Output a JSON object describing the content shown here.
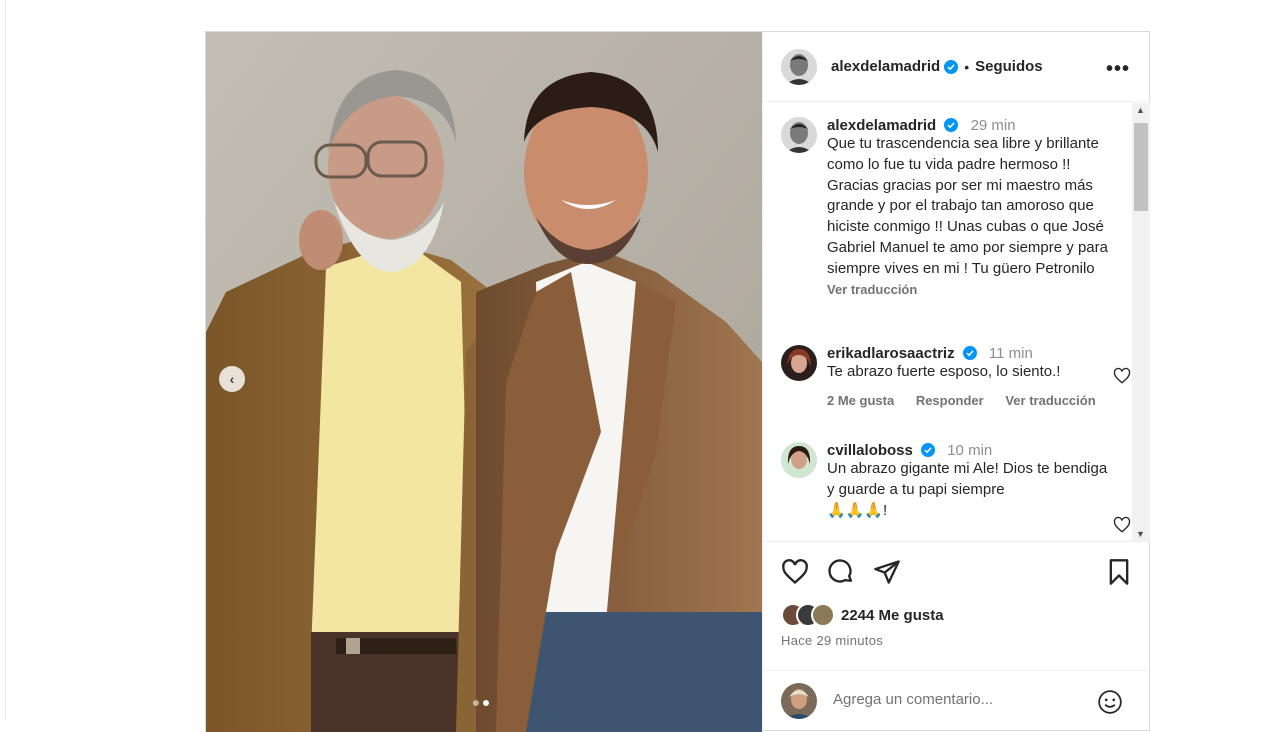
{
  "colors": {
    "verified": "#0095f6",
    "text": "#262626",
    "secondary": "#737373",
    "border": "#dbdbdb"
  },
  "post": {
    "username": "alexdelamadrid",
    "separator": "•",
    "follow_status": "Seguidos",
    "more_icon": "more-horizontal-icon",
    "carousel": {
      "prev_icon": "chevron-left-icon",
      "slides": 2,
      "active_slide": 2
    }
  },
  "caption": {
    "username": "alexdelamadrid",
    "time": "29 min",
    "text": "Que tu trascendencia sea libre y brillante como lo fue tu vida padre hermoso !! Gracias gracias por ser mi maestro más grande y por el trabajo tan amoroso que hiciste conmigo !! Unas cubas o que José Gabriel Manuel te amo por siempre y para siempre vives en mi ! Tu güero Petronilo",
    "translate": "Ver traducción"
  },
  "comments": [
    {
      "username": "erikadlarosaactriz",
      "time": "11 min",
      "text": "Te abrazo fuerte esposo, lo siento.!",
      "likes": "2 Me gusta",
      "reply": "Responder",
      "translate": "Ver traducción"
    },
    {
      "username": "cvillaloboss",
      "time": "10 min",
      "text": "Un abrazo gigante mi Ale! Dios te bendiga y guarde a tu papi siempre",
      "emoji": "🙏🙏🙏!"
    }
  ],
  "actions": {
    "like_icon": "heart-icon",
    "comment_icon": "comment-icon",
    "share_icon": "send-icon",
    "save_icon": "bookmark-icon"
  },
  "likes": {
    "count_label": "2244 Me gusta"
  },
  "posted_ago": "Hace 29 minutos",
  "add_comment": {
    "placeholder": "Agrega un comentario...",
    "emoji_icon": "smiley-icon"
  }
}
